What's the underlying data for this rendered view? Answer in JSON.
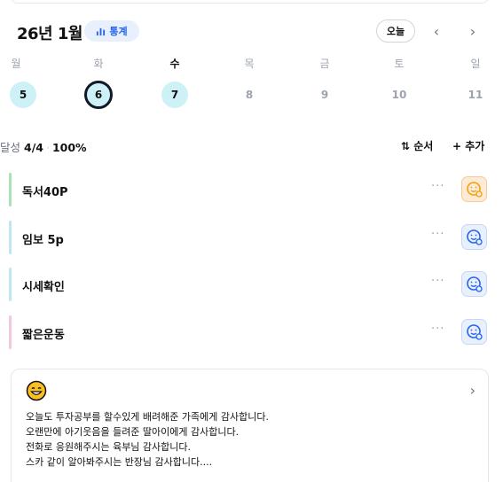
{
  "header": {
    "month_title": "26년 1월",
    "stats_label": "통계",
    "today_label": "오늘",
    "prev_label": "‹",
    "next_label": "›"
  },
  "week": {
    "weekdays": [
      "월",
      "화",
      "수",
      "목",
      "금",
      "토",
      "일"
    ],
    "dates": [
      "5",
      "6",
      "7",
      "8",
      "9",
      "10",
      "11"
    ],
    "done_dates": [
      "5",
      "6",
      "7"
    ],
    "selected_date": "6"
  },
  "summary": {
    "label": "달성",
    "count": "4/4",
    "percent": "100%",
    "sort_label": "⇅ 순서",
    "add_label": "+ 추가"
  },
  "habits": [
    {
      "name": "독서40P",
      "bar_color": "#a7e3b3",
      "face": "orange"
    },
    {
      "name": "임보 5p",
      "bar_color": "#bfe7f3",
      "face": "blue"
    },
    {
      "name": "시세확인",
      "bar_color": "#bfe7f3",
      "face": "blue"
    },
    {
      "name": "짧은운동",
      "bar_color": "#f3c7df",
      "face": "blue"
    }
  ],
  "more_label": "···",
  "journal": {
    "lines": [
      "오늘도 투자공부를 할수있게 배려해준 가족에게 감사합니다.",
      "오랜만에 아기웃음을 들려준 딸아이에게 감사합니다.",
      "전화로 응원해주시는 육부님 감사합니다.",
      "스카 같이 알아봐주시는 반장님 감사합니다...."
    ]
  },
  "colors": {
    "accent_blue": "#2563eb",
    "done_circle": "#cdf1f6",
    "face_orange": "#f59e0b",
    "face_blue": "#2563eb"
  }
}
